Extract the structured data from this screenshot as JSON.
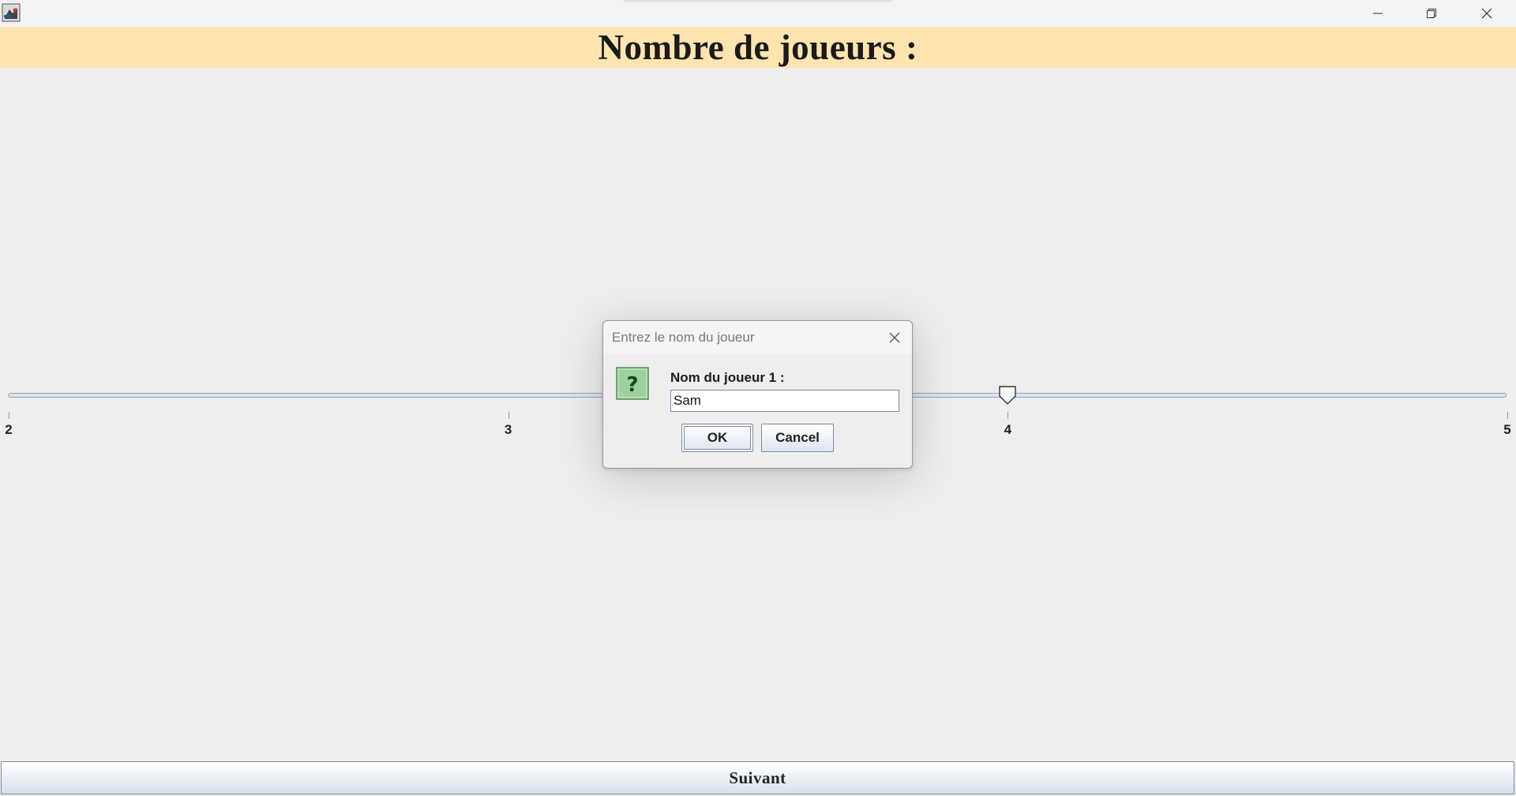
{
  "window": {
    "icons": {
      "app": "app-icon",
      "minimize": "minimize-icon",
      "maximize": "restore-icon",
      "close": "close-icon"
    }
  },
  "header": {
    "title": "Nombre de joueurs :",
    "background": "#ffe4b0"
  },
  "slider": {
    "min": 2,
    "max": 5,
    "value": 4,
    "labels": [
      "2",
      "3",
      "4",
      "5"
    ]
  },
  "dialog": {
    "title": "Entrez le nom du joueur",
    "icon": "question-icon",
    "label": "Nom du joueur 1 :",
    "input_value": "Sam",
    "ok_label": "OK",
    "cancel_label": "Cancel"
  },
  "footer": {
    "next_label": "Suivant"
  }
}
